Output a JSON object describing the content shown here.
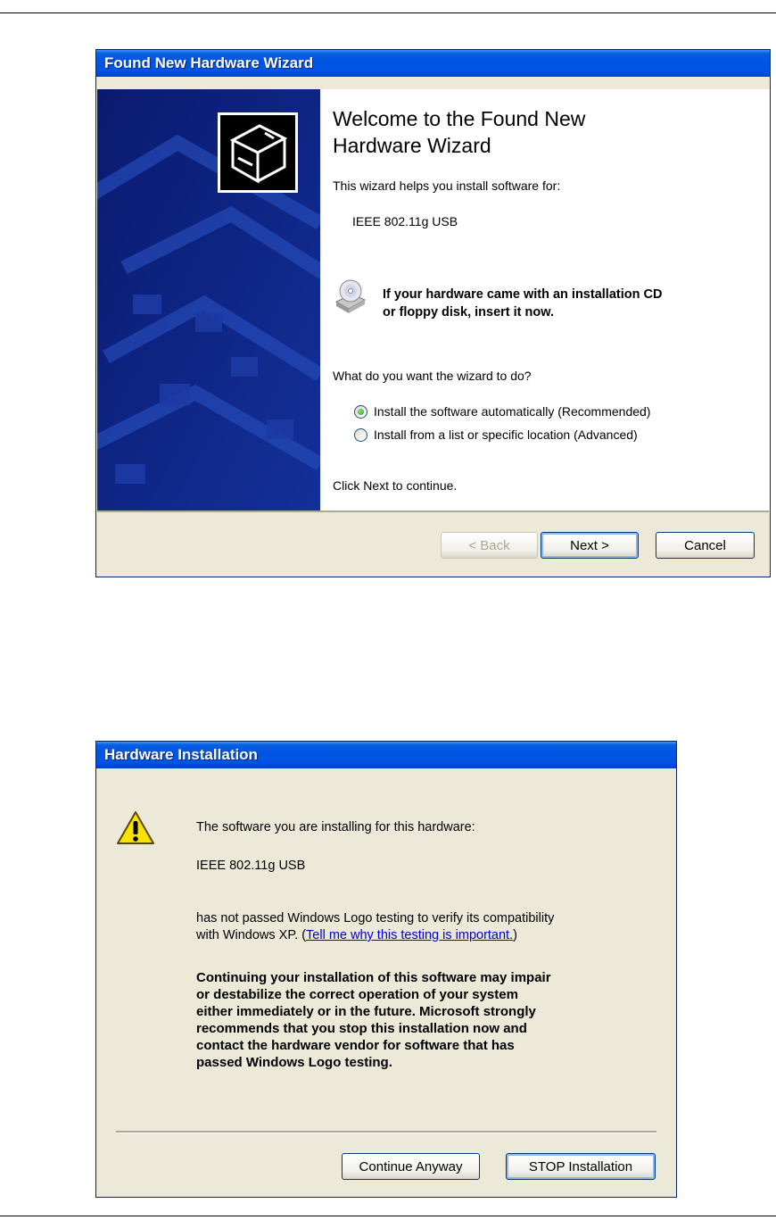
{
  "wizard": {
    "title": "Found New Hardware Wizard",
    "heading_line1": "Welcome to the Found New",
    "heading_line2": "Hardware Wizard",
    "intro": "This wizard helps you install software for:",
    "device": "IEEE 802.11g USB",
    "cd_notice_line1": "If your hardware came with an installation CD",
    "cd_notice_line2": "or floppy disk, insert it now.",
    "question": "What do you want the wizard to do?",
    "options": [
      {
        "label": "Install the software automatically (Recommended)",
        "selected": true
      },
      {
        "label": "Install from a list or specific location (Advanced)",
        "selected": false
      }
    ],
    "footer_hint": "Click Next to continue.",
    "buttons": {
      "back": "< Back",
      "next": "Next >",
      "cancel": "Cancel"
    },
    "icons": [
      "hardware-device-icon",
      "cd-drive-icon"
    ],
    "colors": {
      "title_bar": "#0054e3",
      "side_panel": "#0b1d7a"
    }
  },
  "hardware_install": {
    "title": "Hardware Installation",
    "intro": "The software you are installing for this hardware:",
    "device": "IEEE 802.11g USB",
    "logo_line1": "has not passed Windows Logo testing to verify its compatibility",
    "logo_line2_prefix": "with Windows XP. (",
    "logo_link": "Tell me why this testing is important.",
    "logo_line2_suffix": ")",
    "warning_lines": [
      "Continuing your installation of this software may impair",
      "or destabilize the correct operation of your system",
      "either immediately or in the future. Microsoft strongly",
      "recommends that you stop this installation now and",
      "contact the hardware vendor for software that has",
      "passed Windows Logo testing."
    ],
    "buttons": {
      "continue": "Continue Anyway",
      "stop": "STOP Installation"
    },
    "icons": [
      "warning-icon"
    ]
  }
}
